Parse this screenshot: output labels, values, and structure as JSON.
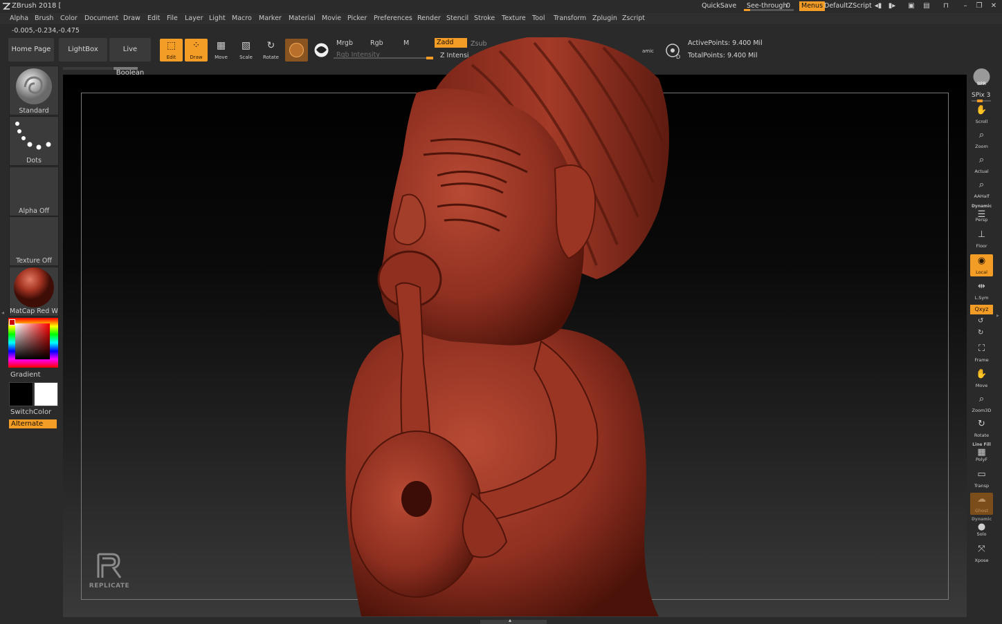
{
  "titlebar": {
    "title": "ZBrush 2018 [",
    "quicksave": "QuickSave",
    "seethrough_label": "See-through",
    "seethrough_value": "0",
    "menus": "Menus",
    "script": "DefaultZScript"
  },
  "menus": [
    "Alpha",
    "Brush",
    "Color",
    "Document",
    "Draw",
    "Edit",
    "File",
    "Layer",
    "Light",
    "Macro",
    "Marker",
    "Material",
    "Movie",
    "Picker",
    "Preferences",
    "Render",
    "Stencil",
    "Stroke",
    "Texture",
    "Tool",
    "Transform",
    "Zplugin",
    "Zscript"
  ],
  "coords": "-0.005,-0.234,-0.475",
  "shelf": {
    "home_page": "Home Page",
    "lightbox": "LightBox",
    "live_boolean": "Live Boolean",
    "edit": "Edit",
    "draw": "Draw",
    "move": "Move",
    "scale": "Scale",
    "rotate": "Rotate",
    "mrgb": "Mrgb",
    "rgb": "Rgb",
    "m": "M",
    "zadd": "Zadd",
    "zsub": "Zsub",
    "rgb_intensity": "Rgb Intensity",
    "z_intensity": "Z Intensi",
    "dynamic": "amic",
    "active_points": "ActivePoints: 9.400 Mil",
    "total_points": "TotalPoints: 9.400 Mil"
  },
  "left": {
    "brush": "Standard",
    "stroke": "Dots",
    "alpha": "Alpha Off",
    "texture": "Texture Off",
    "material": "MatCap Red Wax",
    "gradient": "Gradient",
    "switch_color": "SwitchColor",
    "alternate": "Alternate"
  },
  "right": {
    "bpr": "BPR",
    "spix": "SPix 3",
    "scroll": "Scroll",
    "zoom": "Zoom",
    "actual": "Actual",
    "aahalf": "AAHalf",
    "dynamic_cap": "Dynamic",
    "persp": "Persp",
    "floor": "Floor",
    "local": "Local",
    "lsym": "L.Sym",
    "xyz": "Qxyz",
    "frame": "Frame",
    "move": "Move",
    "zoom3d": "Zoom3D",
    "rotate": "Rotate",
    "linefill_cap": "Line Fill",
    "polyf": "PolyF",
    "transp": "Transp",
    "ghost": "Ghost",
    "dynamic_cap2": "Dynamic",
    "solo": "Solo",
    "xpose": "Xpose"
  },
  "watermark": "REPLICATE",
  "colors": {
    "accent": "#f39c26",
    "model": "#8e2f20",
    "panel": "#2a2a2a"
  }
}
